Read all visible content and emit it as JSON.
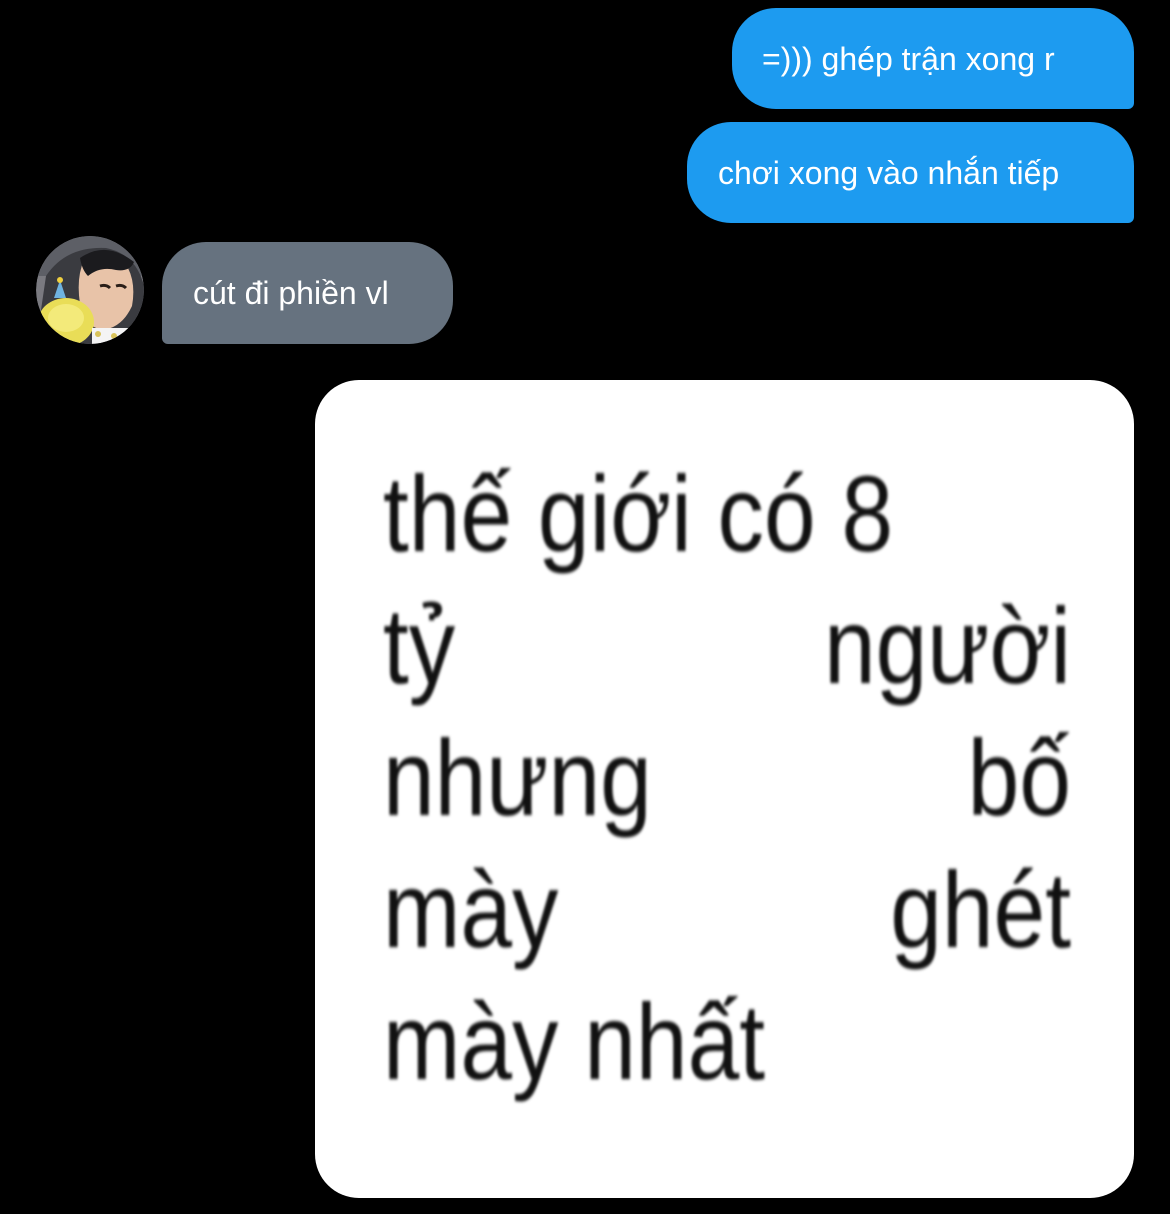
{
  "messages": [
    {
      "direction": "sent",
      "text": "=))) ghép trận xong r"
    },
    {
      "direction": "sent",
      "text": "chơi xong vào nhắn tiếp"
    },
    {
      "direction": "received",
      "text": "cút đi phiền vl"
    }
  ],
  "image_message": {
    "lines": [
      [
        "thế giới có 8"
      ],
      [
        "tỷ",
        "người"
      ],
      [
        "nhưng",
        "bố"
      ],
      [
        "mày",
        "ghét"
      ],
      [
        "mày nhất"
      ]
    ]
  },
  "colors": {
    "background": "#000000",
    "sent_bubble": "#1d9bf0",
    "received_bubble": "#66727f",
    "text": "#ffffff"
  },
  "icons": {
    "avatar": "user-avatar-photo"
  }
}
